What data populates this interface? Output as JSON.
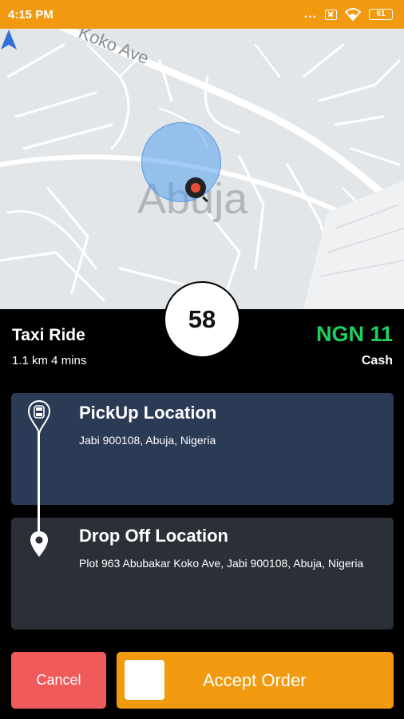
{
  "status_bar": {
    "time": "4:15 PM",
    "dots": "...",
    "battery": "61"
  },
  "map": {
    "street_label": "Koko Ave",
    "city_label": "Abuja"
  },
  "timer": {
    "seconds": "58"
  },
  "ride": {
    "title": "Taxi Ride",
    "meta": "1.1 km 4 mins",
    "fare": "NGN 11",
    "payment": "Cash"
  },
  "pickup": {
    "title": "PickUp Location",
    "address": "Jabi 900108, Abuja, Nigeria"
  },
  "dropoff": {
    "title": "Drop Off Location",
    "address": "Plot 963 Abubakar Koko Ave, Jabi 900108, Abuja, Nigeria"
  },
  "actions": {
    "cancel_label": "Cancel",
    "accept_label": "Accept Order"
  },
  "colors": {
    "accent": "#f19a0f",
    "fare_green": "#1fd05e",
    "cancel_red": "#f15a5b",
    "pickup_card": "#2b3a55",
    "drop_card": "#2a2f38"
  },
  "icons": {
    "pickup": "car-pin-icon",
    "dropoff": "location-pin-icon",
    "user": "navigation-arrow-icon",
    "destination": "search-pin-icon"
  }
}
